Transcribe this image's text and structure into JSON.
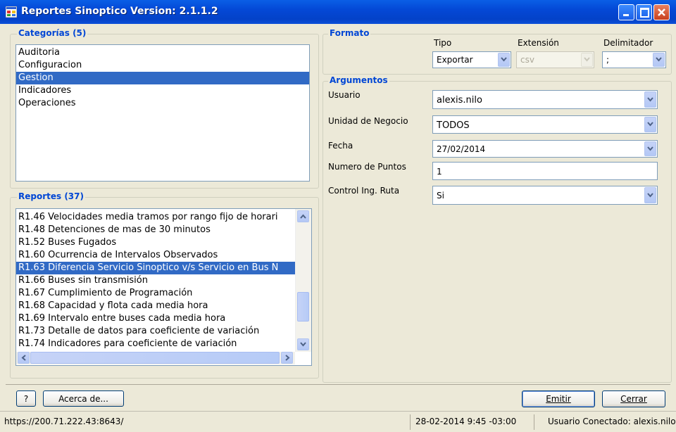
{
  "window": {
    "title": "Reportes Sinoptico Version: 2.1.1.2"
  },
  "categorias": {
    "title": "Categorías (5)",
    "items": [
      "Auditoria",
      "Configuracion",
      "Gestion",
      "Indicadores",
      "Operaciones"
    ],
    "selected": "Gestion"
  },
  "reportes": {
    "title": "Reportes (37)",
    "items": [
      "R1.46 Velocidades media tramos por rango fijo de horari",
      "R1.48 Detenciones de mas de 30 minutos",
      "R1.52 Buses Fugados",
      "R1.60 Ocurrencia de Intervalos Observados",
      "R1.63 Diferencia Servicio Sinoptico v/s Servicio en Bus N",
      "R1.66 Buses sin transmisión",
      "R1.67 Cumplimiento de Programación",
      "R1.68 Capacidad y flota cada media hora",
      "R1.69 Intervalo entre buses cada media hora",
      "R1.73 Detalle de datos para coeficiente de variación",
      "R1.74 Indicadores para coeficiente de variación"
    ],
    "selected": "R1.63 Diferencia Servicio Sinoptico v/s Servicio en Bus N"
  },
  "formato": {
    "title": "Formato",
    "tipo_label": "Tipo",
    "tipo_value": "Exportar",
    "extension_label": "Extensión",
    "extension_value": "csv",
    "delimitador_label": "Delimitador",
    "delimitador_value": ";"
  },
  "argumentos": {
    "title": "Argumentos",
    "usuario_label": "Usuario",
    "usuario_value": "alexis.nilo",
    "unidad_label": "Unidad de Negocio",
    "unidad_value": "TODOS",
    "fecha_label": "Fecha",
    "fecha_value": "27/02/2014",
    "puntos_label": "Numero de Puntos",
    "puntos_value": "1",
    "control_label": "Control Ing. Ruta",
    "control_value": "Si"
  },
  "buttons": {
    "help": "?",
    "about": "Acerca de...",
    "emitir": "Emitir",
    "cerrar": "Cerrar"
  },
  "status": {
    "url": "https://200.71.222.43:8643/",
    "datetime": "28-02-2014 9:45 -03:00",
    "user": "Usuario Conectado: alexis.nilo"
  }
}
